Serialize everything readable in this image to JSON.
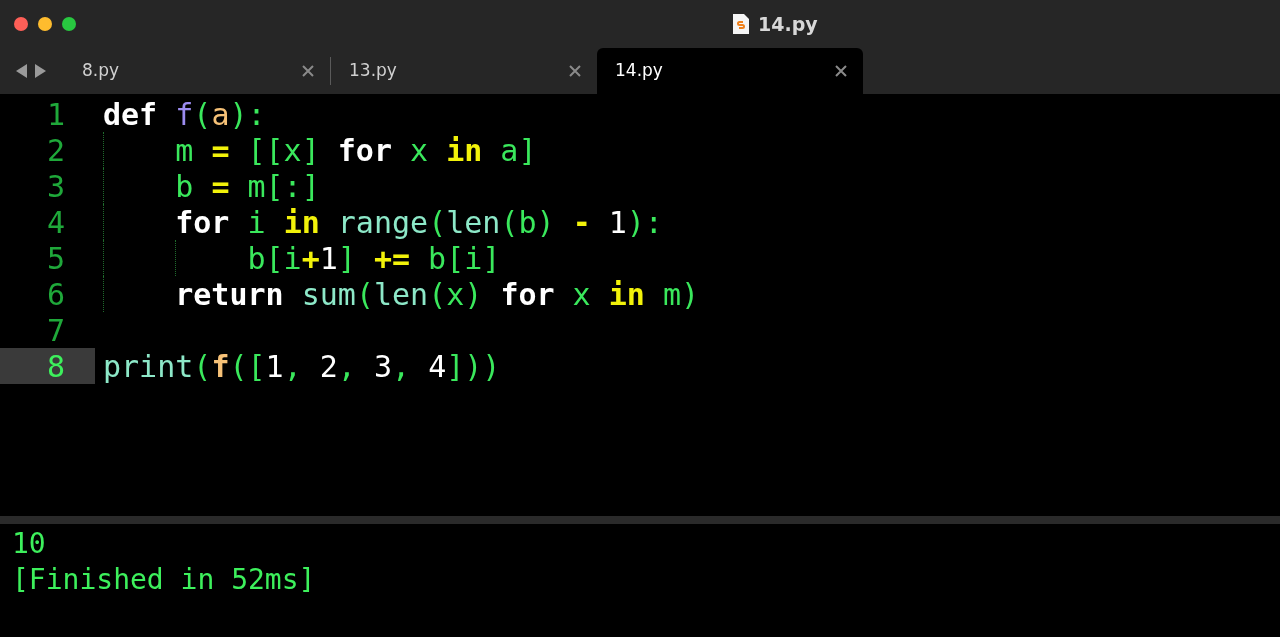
{
  "window": {
    "title": "14.py"
  },
  "tabs": [
    {
      "label": "8.py",
      "selected": false
    },
    {
      "label": "13.py",
      "selected": false
    },
    {
      "label": "14.py",
      "selected": true
    }
  ],
  "editor": {
    "lines": [
      {
        "number": "1",
        "current": false,
        "tokens": [
          {
            "text": "def ",
            "kind": "keyword"
          },
          {
            "text": "f",
            "kind": "function"
          },
          {
            "text": "(",
            "kind": "plain"
          },
          {
            "text": "a",
            "kind": "param"
          },
          {
            "text": "):",
            "kind": "plain"
          }
        ]
      },
      {
        "number": "2",
        "current": false,
        "tokens": [
          {
            "text": "    m ",
            "kind": "plain"
          },
          {
            "text": "=",
            "kind": "operator"
          },
          {
            "text": " [[x] ",
            "kind": "plain"
          },
          {
            "text": "for",
            "kind": "keyword"
          },
          {
            "text": " x ",
            "kind": "plain"
          },
          {
            "text": "in",
            "kind": "operator"
          },
          {
            "text": " a]",
            "kind": "plain"
          }
        ]
      },
      {
        "number": "3",
        "current": false,
        "tokens": [
          {
            "text": "    b ",
            "kind": "plain"
          },
          {
            "text": "=",
            "kind": "operator"
          },
          {
            "text": " m[:]",
            "kind": "plain"
          }
        ]
      },
      {
        "number": "4",
        "current": false,
        "tokens": [
          {
            "text": "    for",
            "kind": "keyword"
          },
          {
            "text": " i ",
            "kind": "plain"
          },
          {
            "text": "in",
            "kind": "operator"
          },
          {
            "text": " range",
            "kind": "builtin"
          },
          {
            "text": "(",
            "kind": "plain"
          },
          {
            "text": "len",
            "kind": "builtin"
          },
          {
            "text": "(b) ",
            "kind": "plain"
          },
          {
            "text": "-",
            "kind": "operator"
          },
          {
            "text": " 1",
            "kind": "number"
          },
          {
            "text": "):",
            "kind": "plain"
          }
        ]
      },
      {
        "number": "5",
        "current": false,
        "tokens": [
          {
            "text": "        b[i",
            "kind": "plain"
          },
          {
            "text": "+",
            "kind": "operator"
          },
          {
            "text": "1",
            "kind": "number"
          },
          {
            "text": "] ",
            "kind": "plain"
          },
          {
            "text": "+=",
            "kind": "operator"
          },
          {
            "text": " b[i]",
            "kind": "plain"
          }
        ]
      },
      {
        "number": "6",
        "current": false,
        "tokens": [
          {
            "text": "    return",
            "kind": "keyword"
          },
          {
            "text": " sum",
            "kind": "builtin"
          },
          {
            "text": "(",
            "kind": "plain"
          },
          {
            "text": "len",
            "kind": "builtin"
          },
          {
            "text": "(x) ",
            "kind": "plain"
          },
          {
            "text": "for",
            "kind": "keyword"
          },
          {
            "text": " x ",
            "kind": "plain"
          },
          {
            "text": "in",
            "kind": "operator"
          },
          {
            "text": " m)",
            "kind": "plain"
          }
        ]
      },
      {
        "number": "7",
        "current": false
      },
      {
        "number": "8",
        "current": true,
        "tokens": [
          {
            "text": "print",
            "kind": "builtin"
          },
          {
            "text": "(",
            "kind": "plain"
          },
          {
            "text": "f",
            "kind": "call"
          },
          {
            "text": "([",
            "kind": "plain"
          },
          {
            "text": "1",
            "kind": "number"
          },
          {
            "text": ", ",
            "kind": "plain"
          },
          {
            "text": "2",
            "kind": "number"
          },
          {
            "text": ", ",
            "kind": "plain"
          },
          {
            "text": "3",
            "kind": "number"
          },
          {
            "text": ", ",
            "kind": "plain"
          },
          {
            "text": "4",
            "kind": "number"
          },
          {
            "text": "]))",
            "kind": "plain"
          }
        ]
      }
    ]
  },
  "output": {
    "lines": [
      "10",
      "[Finished in 52ms]"
    ]
  }
}
